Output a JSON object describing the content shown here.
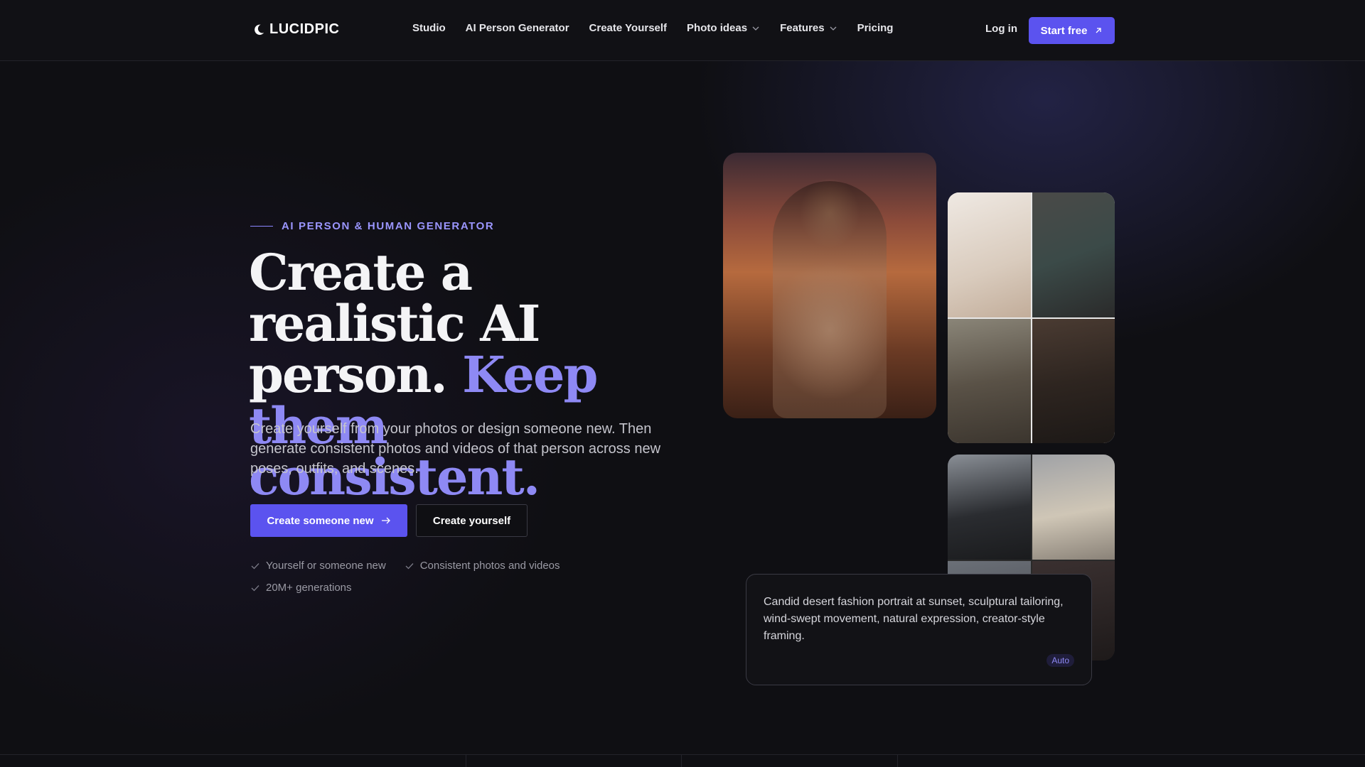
{
  "brand": {
    "name": "LUCIDPIC"
  },
  "nav": {
    "items": [
      {
        "label": "Studio",
        "has_dropdown": false
      },
      {
        "label": "AI Person Generator",
        "has_dropdown": false
      },
      {
        "label": "Create Yourself",
        "has_dropdown": false
      },
      {
        "label": "Photo ideas",
        "has_dropdown": true
      },
      {
        "label": "Features",
        "has_dropdown": true
      },
      {
        "label": "Pricing",
        "has_dropdown": false
      }
    ],
    "login_label": "Log in",
    "start_label": "Start free"
  },
  "hero": {
    "eyebrow": "AI PERSON & HUMAN GENERATOR",
    "headline_part1": "Create a realistic AI person.",
    "headline_accent": "Keep them consistent.",
    "subtext": "Create yourself from your photos or design someone new. Then generate consistent photos and videos of that person across new poses, outfits, and scenes.",
    "primary_cta": "Create someone new",
    "secondary_cta": "Create yourself",
    "checks": [
      "Yourself or someone new",
      "Consistent photos and videos",
      "20M+ generations"
    ]
  },
  "prompt_card": {
    "text": "Candid desert fashion portrait at sunset, sculptural tailoring, wind-swept movement, natural expression, creator-style framing.",
    "badge": "Auto"
  },
  "colors": {
    "accent": "#5b53ef",
    "accent_text": "#8e89f4",
    "background": "#0f0f13"
  }
}
